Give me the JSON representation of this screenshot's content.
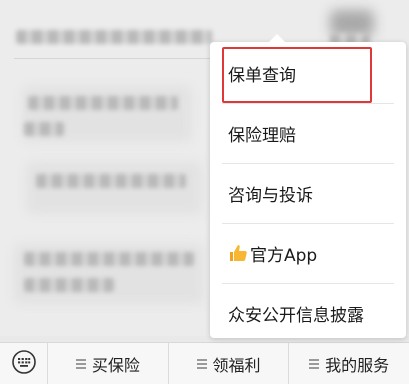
{
  "popup_menu": {
    "items": [
      {
        "label": "保单查询"
      },
      {
        "label": "保险理赔"
      },
      {
        "label": "咨询与投诉"
      },
      {
        "label": "官方App",
        "icon": "thumbs-up-icon"
      },
      {
        "label": "众安公开信息披露"
      }
    ],
    "highlight_color": "#e03838"
  },
  "bottom_bar": {
    "tabs": [
      {
        "label": "买保险"
      },
      {
        "label": "领福利"
      },
      {
        "label": "我的服务"
      }
    ]
  }
}
